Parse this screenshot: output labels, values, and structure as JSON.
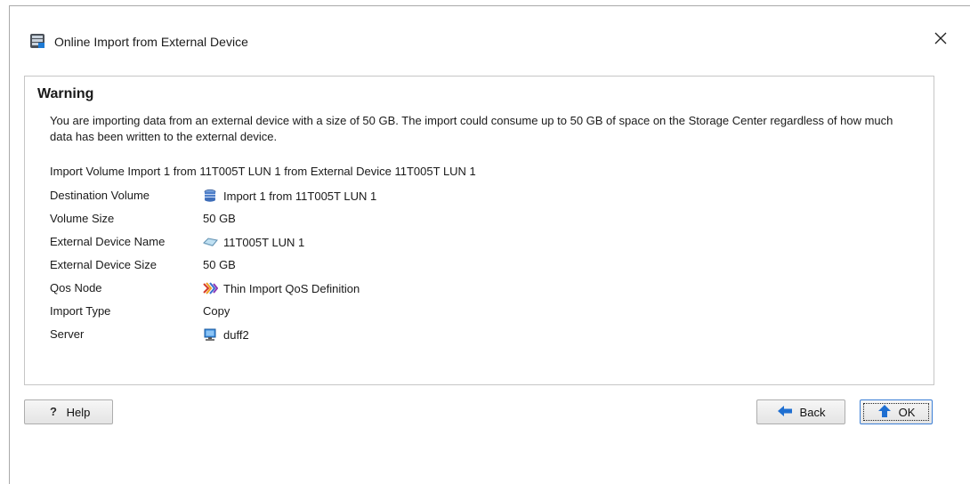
{
  "window": {
    "title": "Online Import from External Device",
    "close_symbol": "✕"
  },
  "warning": {
    "heading": "Warning",
    "message": "You are importing data from an external device with a size of 50 GB. The import could consume up to 50 GB of space on the Storage Center regardless of how much data has been written to the external device.",
    "import_line": "Import Volume Import 1 from 11T005T LUN 1 from External Device 11T005T LUN 1"
  },
  "details": {
    "destination_volume": {
      "label": "Destination Volume",
      "value": "Import 1 from 11T005T LUN 1",
      "icon": "volume-icon"
    },
    "volume_size": {
      "label": "Volume Size",
      "value": "50 GB"
    },
    "external_device_name": {
      "label": "External Device Name",
      "value": "11T005T LUN 1",
      "icon": "external-disk-icon"
    },
    "external_device_size": {
      "label": "External Device Size",
      "value": "50 GB"
    },
    "qos_node": {
      "label": "Qos Node",
      "value": "Thin Import QoS Definition",
      "icon": "qos-icon"
    },
    "import_type": {
      "label": "Import Type",
      "value": "Copy"
    },
    "server": {
      "label": "Server",
      "value": "duff2",
      "icon": "server-icon"
    }
  },
  "buttons": {
    "help": "Help",
    "back": "Back",
    "ok": "OK"
  },
  "colors": {
    "accent": "#1f6fd1",
    "border": "#c6c6c6"
  }
}
